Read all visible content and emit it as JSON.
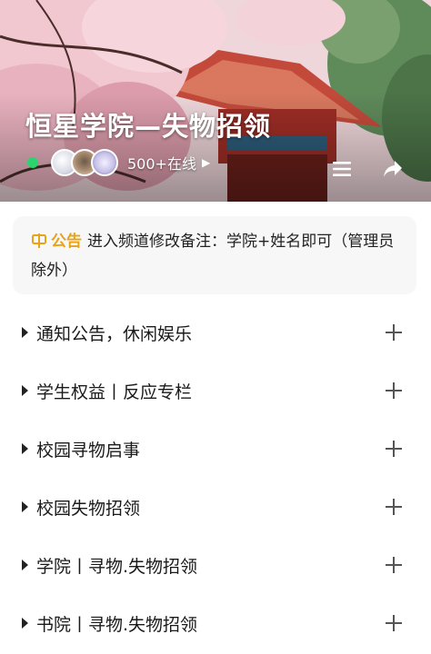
{
  "header": {
    "title": "恒星学院—失物招领",
    "online_count": "500+在线",
    "online_arrow_icon": "chevron-right-icon",
    "menu_icon": "menu-icon",
    "share_icon": "share-icon",
    "online_status_color": "#2bd46e"
  },
  "announcement": {
    "icon": "megaphone-icon",
    "label": "公告",
    "text": "进入频道修改备注：学院+姓名即可（管理员除外）",
    "label_color": "#e8a317"
  },
  "sections": [
    {
      "label": "通知公告，休闲娱乐"
    },
    {
      "label": "学生权益丨反应专栏"
    },
    {
      "label": "校园寻物启事"
    },
    {
      "label": "校园失物招领"
    },
    {
      "label": "学院丨寻物.失物招领"
    },
    {
      "label": "书院丨寻物.失物招领"
    }
  ]
}
